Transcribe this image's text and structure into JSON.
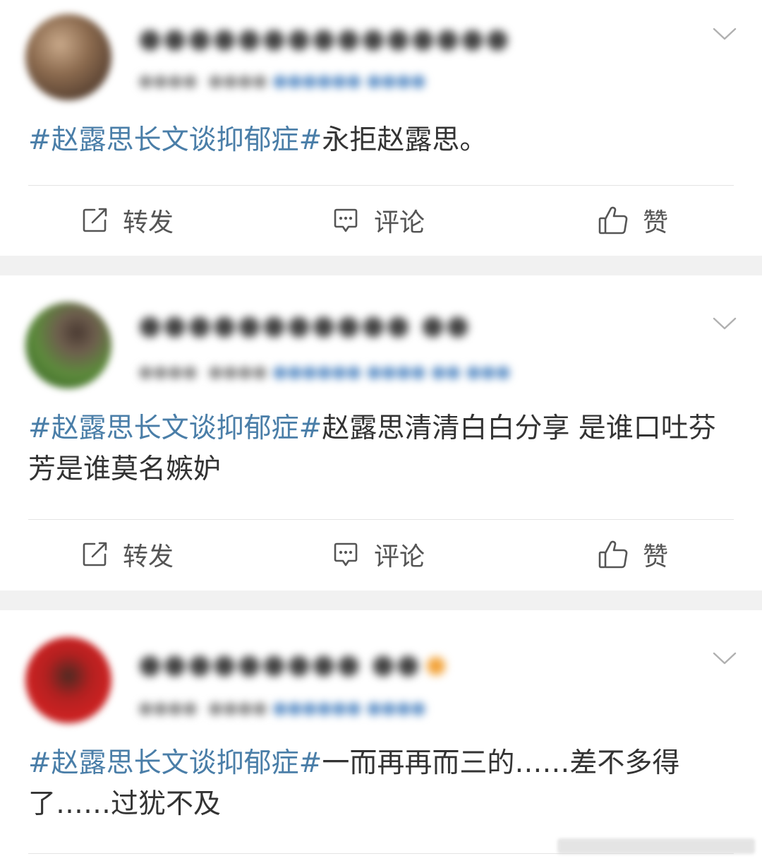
{
  "posts": [
    {
      "hashtag": "#赵露思长文谈抑郁症#",
      "body": "永拒赵露思。",
      "actions": {
        "repost": "转发",
        "comment": "评论",
        "like": "赞"
      }
    },
    {
      "hashtag": "#赵露思长文谈抑郁症#",
      "body": "赵露思清清白白分享 是谁口吐芬芳是谁莫名嫉妒",
      "actions": {
        "repost": "转发",
        "comment": "评论",
        "like": "赞"
      }
    },
    {
      "hashtag": "#赵露思长文谈抑郁症#",
      "body": "一而再再而三的……差不多得了……过犹不及",
      "actions": {
        "repost": "转发",
        "comment": "评论",
        "like": "赞"
      }
    }
  ],
  "icons": {
    "repost": "edit-square-icon",
    "comment": "comment-bubble-icon",
    "like": "thumbs-up-icon",
    "more": "chevron-down-icon"
  },
  "colors": {
    "hashtag": "#4a7ea8",
    "text": "#333333",
    "action_text": "#555555",
    "separator_bg": "#f1f1f1"
  }
}
